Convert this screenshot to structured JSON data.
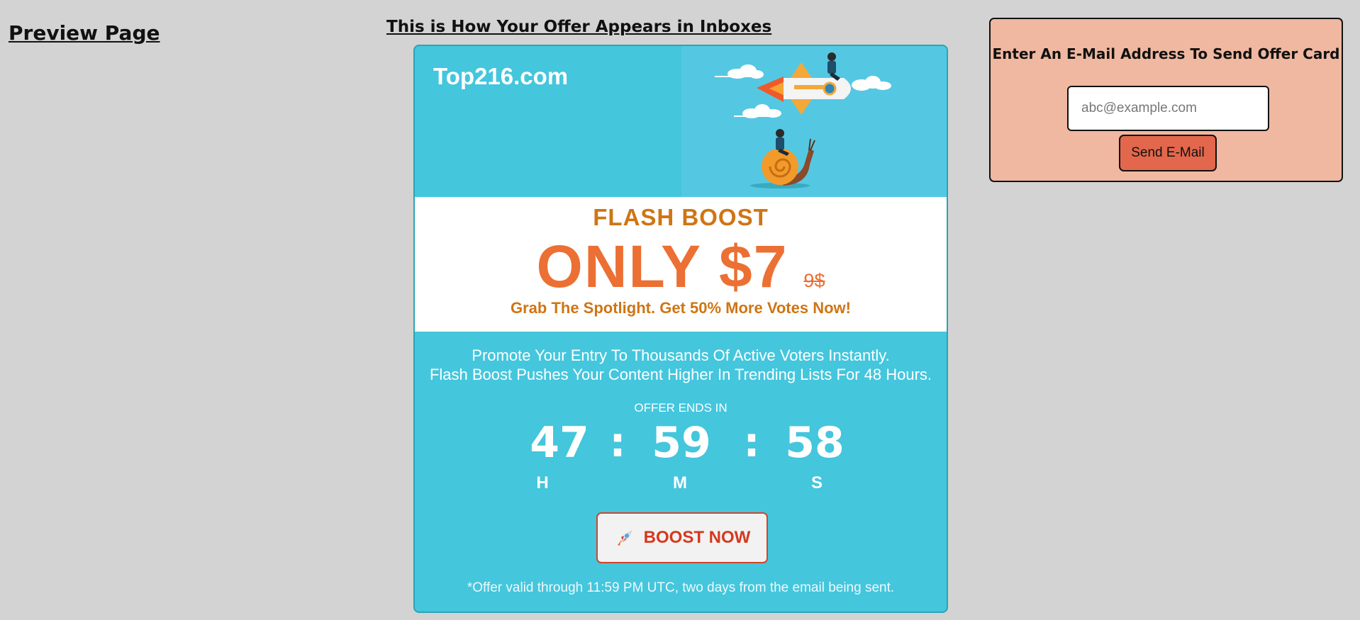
{
  "page": {
    "title": "Preview Page",
    "card_heading": "This is How Your Offer Appears in Inboxes"
  },
  "offer_card": {
    "site_name": "Top216.com",
    "hero_image": "rocket-vs-snail-illustration",
    "flash_title": "FLASH BOOST",
    "price": "ONLY $7",
    "old_price": "9$",
    "tagline": "Grab The Spotlight. Get 50% More Votes Now!",
    "description": [
      "Promote Your Entry To Thousands Of Active Voters Instantly.",
      "Flash Boost Pushes Your Content Higher In Trending Lists For 48 Hours."
    ],
    "offer_ends_label": "OFFER ENDS IN",
    "countdown": {
      "hours": "47",
      "minutes": "59",
      "seconds": "58",
      "separator": ":",
      "hours_unit": "H",
      "minutes_unit": "M",
      "seconds_unit": "S"
    },
    "cta": {
      "icon": "rocket-icon",
      "label": "BOOST NOW"
    },
    "footnote": "*Offer valid through 11:59 PM UTC, two days from the email being sent.",
    "colors": {
      "card_bg": "#44c6dd",
      "price_orange": "#ec6f33",
      "accent_orange": "#cf7514",
      "cta_red": "#d6381f"
    }
  },
  "send_panel": {
    "heading": "Enter An E-Mail Address To Send Offer Card",
    "email_value": "",
    "email_placeholder": "abc@example.com",
    "send_label": "Send E-Mail",
    "colors": {
      "panel_bg": "#f0b8a0",
      "button_bg": "#e2674c"
    }
  }
}
